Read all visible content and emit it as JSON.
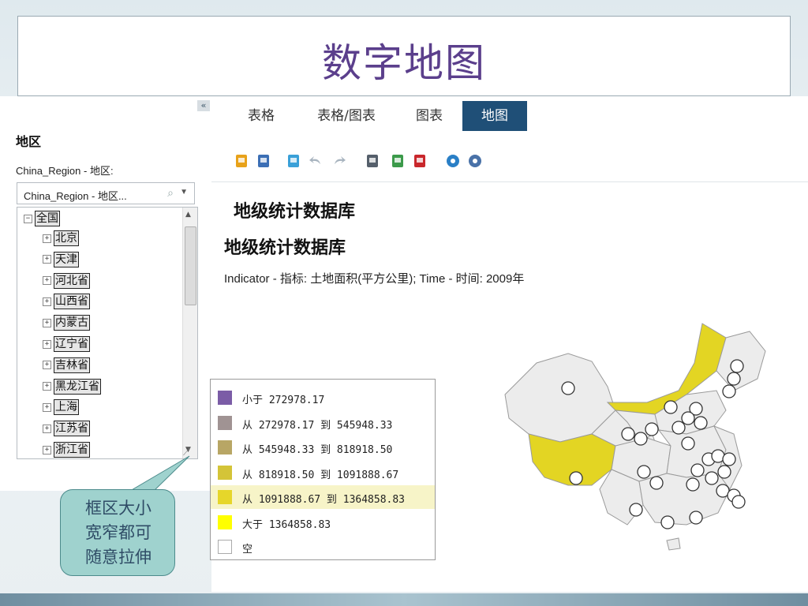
{
  "slide": {
    "title": "数字地图"
  },
  "left_panel": {
    "collapse_label": "«",
    "heading": "地区",
    "dimension_label": "China_Region - 地区:",
    "dropdown_value": "China_Region - 地区...",
    "tree_root": "全国",
    "tree_items": [
      "北京",
      "天津",
      "河北省",
      "山西省",
      "内蒙古",
      "辽宁省",
      "吉林省",
      "黑龙江省",
      "上海",
      "江苏省",
      "浙江省"
    ]
  },
  "tabs": [
    {
      "label": "表格",
      "active": false
    },
    {
      "label": "表格/图表",
      "active": false
    },
    {
      "label": "图表",
      "active": false
    },
    {
      "label": "地图",
      "active": true
    }
  ],
  "toolbar": {
    "icons": [
      "export-icon",
      "save-icon",
      "refresh-icon",
      "undo-icon",
      "redo-icon",
      "print-icon",
      "excel-icon",
      "pdf-icon",
      "table-view-icon",
      "settings-icon"
    ],
    "colors": [
      "#e8a21a",
      "#3c6fb5",
      "#3aa0d8",
      "#a8b4bf",
      "#a8b4bf",
      "#555f6b",
      "#3c9a4a",
      "#c9272c",
      "#2a7fc6",
      "#4a72a8"
    ]
  },
  "report": {
    "title": "地级统计数据库",
    "subtitle": "Indicator - 指标: 土地面积(平方公里); Time - 时间: 2009年"
  },
  "legend": [
    {
      "label": "小于 272978.17",
      "color": "#7b5ca6"
    },
    {
      "label": "从 272978.17 到 545948.33",
      "color": "#a09393"
    },
    {
      "label": "从 545948.33 到 818918.50",
      "color": "#b8a665"
    },
    {
      "label": "从 818918.50 到 1091888.67",
      "color": "#d4c438"
    },
    {
      "label": "从 1091888.67 到 1364858.83",
      "color": "#e6d62a",
      "highlighted": true
    },
    {
      "label": "大于 1364858.83",
      "color": "#ffff00"
    },
    {
      "label": "空",
      "color": "#ffffff"
    }
  ],
  "callout": {
    "lines": [
      "框区大小",
      "宽窄都可",
      "随意拉伸"
    ]
  },
  "map": {
    "default_fill": "#ececec",
    "highlight_fill": "#e3d523",
    "marker_fill": "#ffffff"
  }
}
